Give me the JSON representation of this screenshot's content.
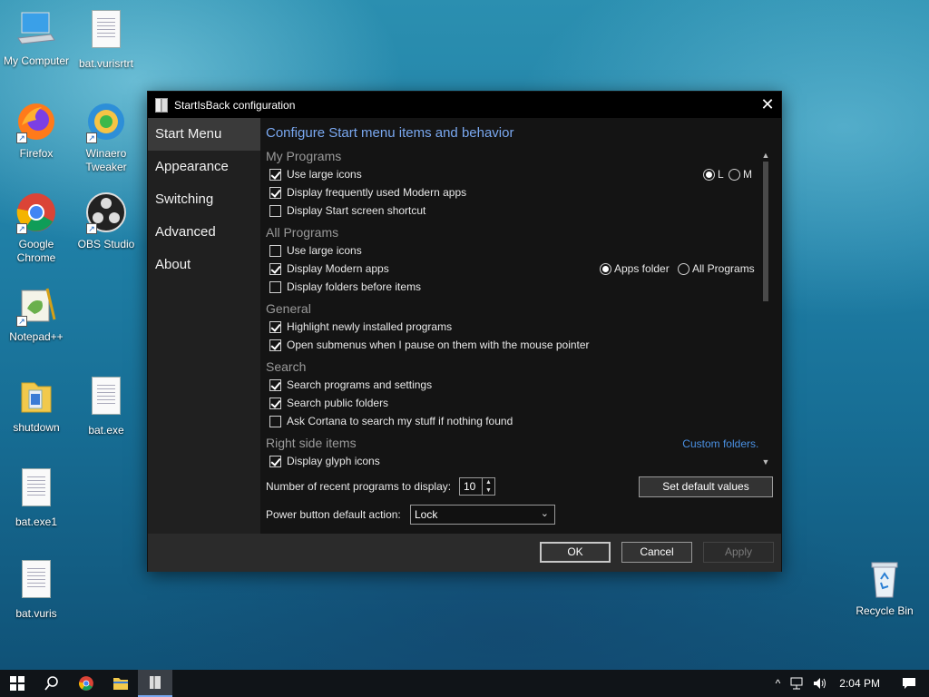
{
  "desktop": {
    "icons": [
      {
        "label": "My Computer",
        "icon": "computer-icon"
      },
      {
        "label": "bat.vurisrtrt",
        "icon": "document-icon"
      },
      {
        "label": "Firefox",
        "icon": "firefox-icon"
      },
      {
        "label": "Winaero Tweaker",
        "icon": "winaero-icon"
      },
      {
        "label": "Google Chrome",
        "icon": "chrome-icon"
      },
      {
        "label": "OBS Studio",
        "icon": "obs-icon"
      },
      {
        "label": "Notepad++",
        "icon": "notepadpp-icon"
      },
      {
        "label": "shutdown",
        "icon": "folder-icon"
      },
      {
        "label": "bat.exe",
        "icon": "document-icon"
      },
      {
        "label": "bat.exe1",
        "icon": "document-icon"
      },
      {
        "label": "bat.vuris",
        "icon": "document-icon"
      },
      {
        "label": "Recycle Bin",
        "icon": "recycle-bin-icon"
      }
    ]
  },
  "window": {
    "title": "StartIsBack configuration",
    "close_glyph": "✕"
  },
  "sidebar": {
    "items": [
      {
        "label": "Start Menu",
        "active": true
      },
      {
        "label": "Appearance",
        "active": false
      },
      {
        "label": "Switching",
        "active": false
      },
      {
        "label": "Advanced",
        "active": false
      },
      {
        "label": "About",
        "active": false
      }
    ]
  },
  "content": {
    "heading": "Configure Start menu items and behavior",
    "sections": {
      "my_programs": "My Programs",
      "all_programs": "All Programs",
      "general": "General",
      "search": "Search",
      "right_side": "Right side items"
    },
    "options": {
      "mp_large_icons": {
        "label": "Use large icons",
        "checked": true
      },
      "mp_modern_apps": {
        "label": "Display frequently used Modern apps",
        "checked": true
      },
      "mp_start_screen": {
        "label": "Display Start screen shortcut",
        "checked": false
      },
      "ap_large_icons": {
        "label": "Use large icons",
        "checked": false
      },
      "ap_modern_apps": {
        "label": "Display Modern apps",
        "checked": true
      },
      "ap_folders_before": {
        "label": "Display folders before items",
        "checked": false
      },
      "gen_highlight": {
        "label": "Highlight newly installed programs",
        "checked": true
      },
      "gen_submenus": {
        "label": "Open submenus when I pause on them with the mouse pointer",
        "checked": true
      },
      "search_programs": {
        "label": "Search programs and settings",
        "checked": true
      },
      "search_public": {
        "label": "Search public folders",
        "checked": true
      },
      "search_cortana": {
        "label": "Ask Cortana to search my stuff if nothing found",
        "checked": false
      },
      "rs_glyph_icons": {
        "label": "Display glyph icons",
        "checked": true
      }
    },
    "icon_size_radios": [
      {
        "label": "L",
        "selected": true
      },
      {
        "label": "M",
        "selected": false
      }
    ],
    "modern_apps_radios": [
      {
        "label": "Apps folder",
        "selected": true
      },
      {
        "label": "All Programs",
        "selected": false
      }
    ],
    "custom_folders_link": "Custom folders...",
    "recent_programs_label": "Number of recent programs to display:",
    "recent_programs_value": "10",
    "power_button_label": "Power button default action:",
    "power_button_value": "Lock",
    "set_default_label": "Set default values"
  },
  "footer": {
    "ok_label": "OK",
    "cancel_label": "Cancel",
    "apply_label": "Apply"
  },
  "taskbar": {
    "time": "2:04 PM"
  }
}
